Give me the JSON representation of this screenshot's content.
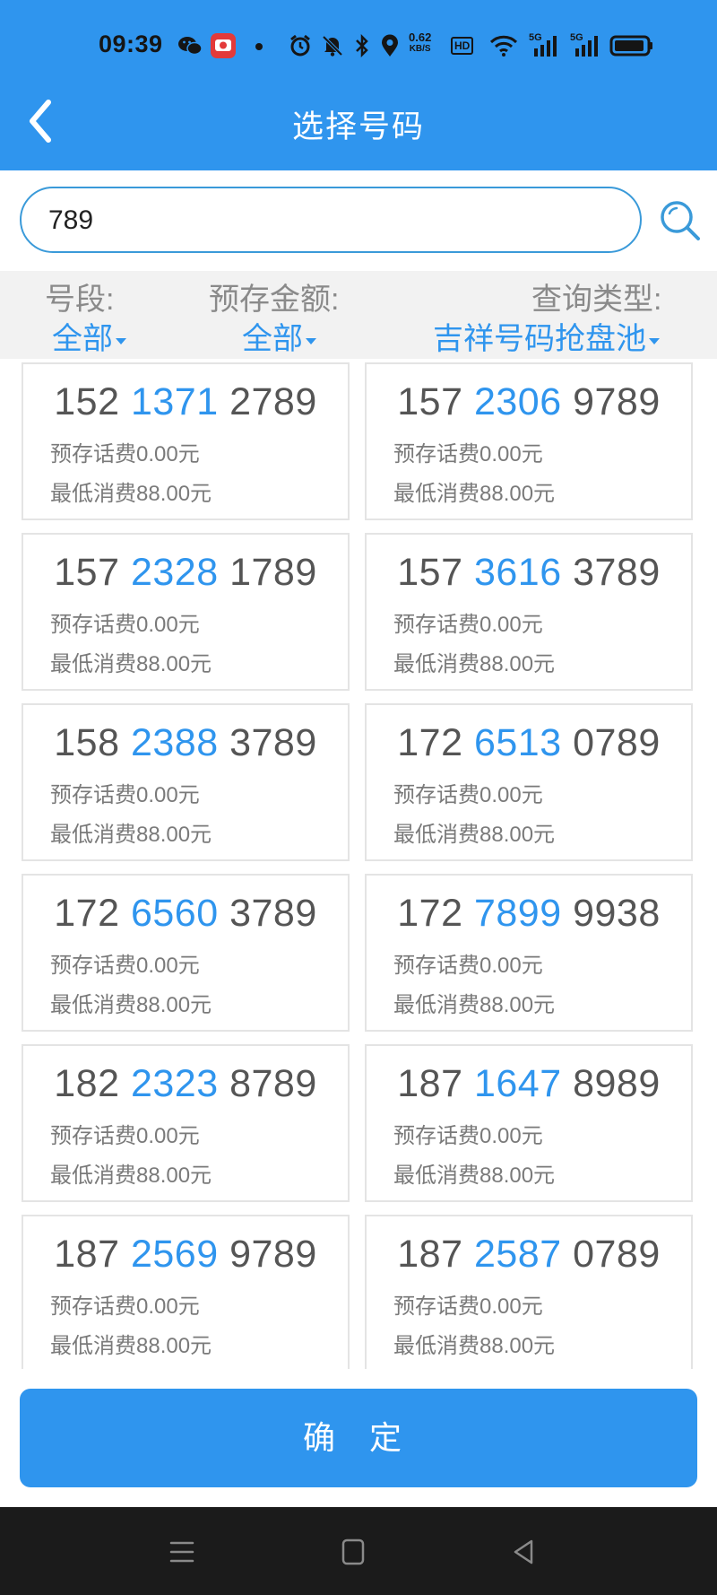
{
  "status_bar": {
    "time": "09:39",
    "net_speed_value": "0.62",
    "net_speed_unit": "KB/S",
    "hd_label": "HD",
    "sim1_label": "5G",
    "sim2_label": "5G",
    "icons": [
      "wechat-icon",
      "app-icon",
      "dot-icon",
      "alarm-icon",
      "mute-icon",
      "bluetooth-icon",
      "location-icon",
      "wifi-icon",
      "signal-icon",
      "battery-icon"
    ]
  },
  "header": {
    "title": "选择号码",
    "back_icon": "chevron-left-icon",
    "background": "#2f95ee"
  },
  "search": {
    "value": "789",
    "icon": "search-icon",
    "border_color": "#3a9ad9"
  },
  "filters": [
    {
      "label": "号段:",
      "value": "全部"
    },
    {
      "label": "预存金额:",
      "value": "全部"
    },
    {
      "label": "查询类型:",
      "value": "吉祥号码抢盘池"
    }
  ],
  "numbers": [
    {
      "prefix": "152",
      "middle": "1371",
      "suffix": "2789",
      "prestore": "预存话费0.00元",
      "min_consume": "最低消费88.00元"
    },
    {
      "prefix": "157",
      "middle": "2306",
      "suffix": "9789",
      "prestore": "预存话费0.00元",
      "min_consume": "最低消费88.00元"
    },
    {
      "prefix": "157",
      "middle": "2328",
      "suffix": "1789",
      "prestore": "预存话费0.00元",
      "min_consume": "最低消费88.00元"
    },
    {
      "prefix": "157",
      "middle": "3616",
      "suffix": "3789",
      "prestore": "预存话费0.00元",
      "min_consume": "最低消费88.00元"
    },
    {
      "prefix": "158",
      "middle": "2388",
      "suffix": "3789",
      "prestore": "预存话费0.00元",
      "min_consume": "最低消费88.00元"
    },
    {
      "prefix": "172",
      "middle": "6513",
      "suffix": "0789",
      "prestore": "预存话费0.00元",
      "min_consume": "最低消费88.00元"
    },
    {
      "prefix": "172",
      "middle": "6560",
      "suffix": "3789",
      "prestore": "预存话费0.00元",
      "min_consume": "最低消费88.00元"
    },
    {
      "prefix": "172",
      "middle": "7899",
      "suffix": "9938",
      "prestore": "预存话费0.00元",
      "min_consume": "最低消费88.00元"
    },
    {
      "prefix": "182",
      "middle": "2323",
      "suffix": "8789",
      "prestore": "预存话费0.00元",
      "min_consume": "最低消费88.00元"
    },
    {
      "prefix": "187",
      "middle": "1647",
      "suffix": "8989",
      "prestore": "预存话费0.00元",
      "min_consume": "最低消费88.00元"
    },
    {
      "prefix": "187",
      "middle": "2569",
      "suffix": "9789",
      "prestore": "预存话费0.00元",
      "min_consume": "最低消费88.00元"
    },
    {
      "prefix": "187",
      "middle": "2587",
      "suffix": "0789",
      "prestore": "预存话费0.00元",
      "min_consume": "最低消费88.00元"
    }
  ],
  "confirm_button": {
    "label": "确 定"
  },
  "system_nav": {
    "icons": [
      "menu-icon",
      "home-icon",
      "back-icon"
    ]
  },
  "colors": {
    "accent": "#2f95ee",
    "number_text": "#555555",
    "secondary_text": "#7a7a7a",
    "filter_background": "#f2f2f2"
  }
}
